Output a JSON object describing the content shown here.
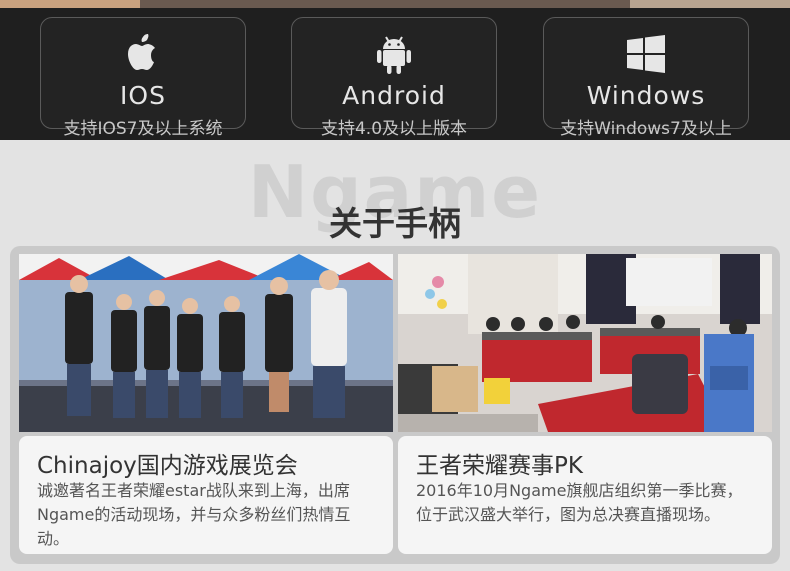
{
  "platforms": [
    {
      "name": "IOS",
      "desc": "支持IOS7及以上系统",
      "icon": "apple-icon"
    },
    {
      "name": "Android",
      "desc": "支持4.0及以上版本",
      "icon": "android-icon"
    },
    {
      "name": "Windows",
      "desc": "支持Windows7及以上",
      "icon": "windows-icon"
    }
  ],
  "section": {
    "bg_title": "Ngame",
    "title": "关于手柄"
  },
  "cards": [
    {
      "title": "Chinajoy国内游戏展览会",
      "text": "诚邀著名王者荣耀estar战队来到上海，出席Ngame的活动现场，并与众多粉丝们热情互动。"
    },
    {
      "title": "王者荣耀赛事PK",
      "text": "2016年10月Ngame旗舰店组织第一季比赛，位于武汉盛大举行，图为总决赛直播现场。"
    }
  ],
  "colors": {
    "dark_bar": "#1f1f1f",
    "page_bg": "#e3e3e3",
    "accent_red": "#c0282e"
  }
}
